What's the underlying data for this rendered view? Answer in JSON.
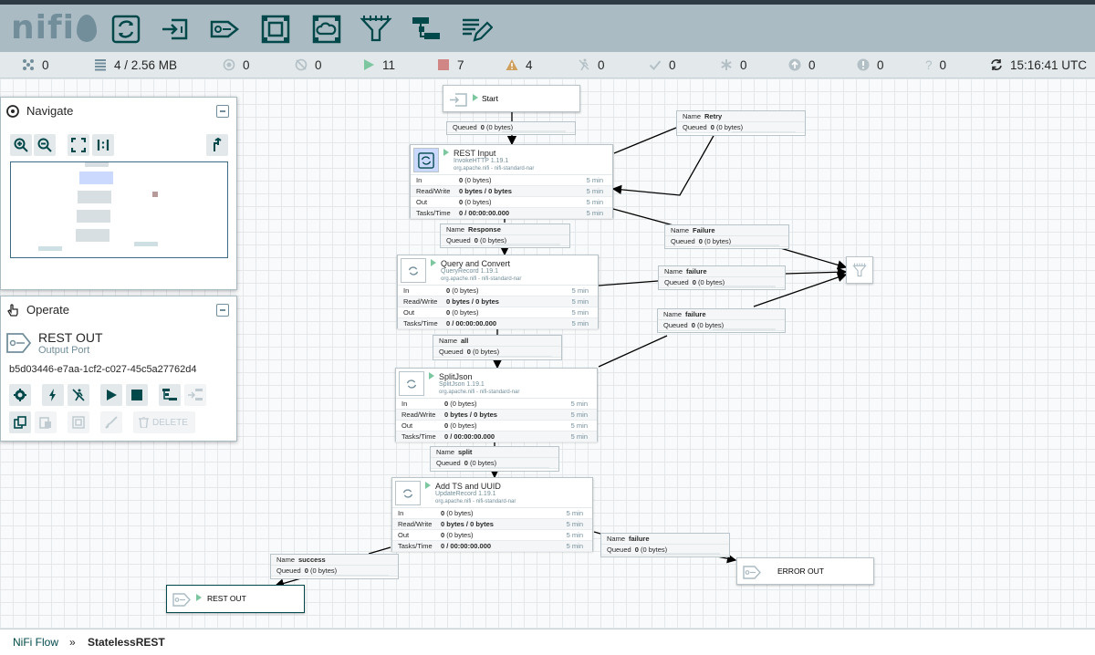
{
  "app": {
    "logo": "nifi"
  },
  "toolbar": {
    "items": [
      "processor-icon",
      "input-port-icon",
      "output-port-icon",
      "process-group-icon",
      "remote-process-group-icon",
      "funnel-icon",
      "template-icon",
      "label-icon"
    ]
  },
  "status": {
    "transmitting": "0",
    "queued": "4 / 2.56 MB",
    "transmitting_rpg": "0",
    "not_transmitting_rpg": "0",
    "running": "11",
    "stopped": "7",
    "invalid": "4",
    "disabled": "0",
    "up_to_date": "0",
    "locally_modified": "0",
    "stale": "0",
    "locally_modified_stale": "0",
    "sync_failure": "0",
    "last_refreshed": "15:16:41 UTC"
  },
  "navigate": {
    "title": "Navigate"
  },
  "operate": {
    "title": "Operate",
    "component_name": "REST OUT",
    "component_type": "Output Port",
    "component_id": "b5d03446-e7aa-1cf2-c027-45c5a27762d4",
    "delete_label": "DELETE"
  },
  "canvas": {
    "ports": {
      "start": "Start",
      "rest_out": "REST OUT",
      "error_out": "ERROR OUT"
    },
    "processors": [
      {
        "name": "REST Input",
        "type": "InvokeHTTP 1.19.1",
        "bundle": "org.apache.nifi - nifi-standard-nar",
        "in_v": "0",
        "in_n": "(0 bytes)",
        "rw": "0 bytes / 0 bytes",
        "out_v": "0",
        "out_n": "(0 bytes)",
        "tasks": "0 / 00:00:00.000",
        "window": "5 min"
      },
      {
        "name": "Query and Convert",
        "type": "QueryRecord 1.19.1",
        "bundle": "org.apache.nifi - nifi-standard-nar",
        "in_v": "0",
        "in_n": "(0 bytes)",
        "rw": "0 bytes / 0 bytes",
        "out_v": "0",
        "out_n": "(0 bytes)",
        "tasks": "0 / 00:00:00.000",
        "window": "5 min"
      },
      {
        "name": "SplitJson",
        "type": "SplitJson 1.19.1",
        "bundle": "org.apache.nifi - nifi-standard-nar",
        "in_v": "0",
        "in_n": "(0 bytes)",
        "rw": "0 bytes / 0 bytes",
        "out_v": "0",
        "out_n": "(0 bytes)",
        "tasks": "0 / 00:00:00.000",
        "window": "5 min"
      },
      {
        "name": "Add TS and UUID",
        "type": "UpdateRecord 1.19.1",
        "bundle": "org.apache.nifi - nifi-standard-nar",
        "in_v": "0",
        "in_n": "(0 bytes)",
        "rw": "0 bytes / 0 bytes",
        "out_v": "0",
        "out_n": "(0 bytes)",
        "tasks": "0 / 00:00:00.000",
        "window": "5 min"
      }
    ],
    "row_labels": {
      "in": "In",
      "rw": "Read/Write",
      "out": "Out",
      "tasks": "Tasks/Time"
    },
    "connections": [
      {
        "name": "",
        "queued_v": "0",
        "queued_n": "(0 bytes)"
      },
      {
        "name": "Retry",
        "queued_v": "0",
        "queued_n": "(0 bytes)"
      },
      {
        "name": "Response",
        "queued_v": "0",
        "queued_n": "(0 bytes)"
      },
      {
        "name": "Failure",
        "queued_v": "0",
        "queued_n": "(0 bytes)"
      },
      {
        "name": "failure",
        "queued_v": "0",
        "queued_n": "(0 bytes)"
      },
      {
        "name": "failure",
        "queued_v": "0",
        "queued_n": "(0 bytes)"
      },
      {
        "name": "all",
        "queued_v": "0",
        "queued_n": "(0 bytes)"
      },
      {
        "name": "split",
        "queued_v": "0",
        "queued_n": "(0 bytes)"
      },
      {
        "name": "failure",
        "queued_v": "0",
        "queued_n": "(0 bytes)"
      },
      {
        "name": "success",
        "queued_v": "0",
        "queued_n": "(0 bytes)"
      }
    ],
    "labels": {
      "name": "Name",
      "queued": "Queued"
    }
  },
  "breadcrumb": {
    "root": "NiFi Flow",
    "sep": "»",
    "current": "StatelessREST"
  },
  "colors": {
    "header": "#aabbc3",
    "icon": "#004849",
    "running": "#7dc7a0",
    "stopped": "#d18686",
    "invalid": "#cf9f5d"
  }
}
